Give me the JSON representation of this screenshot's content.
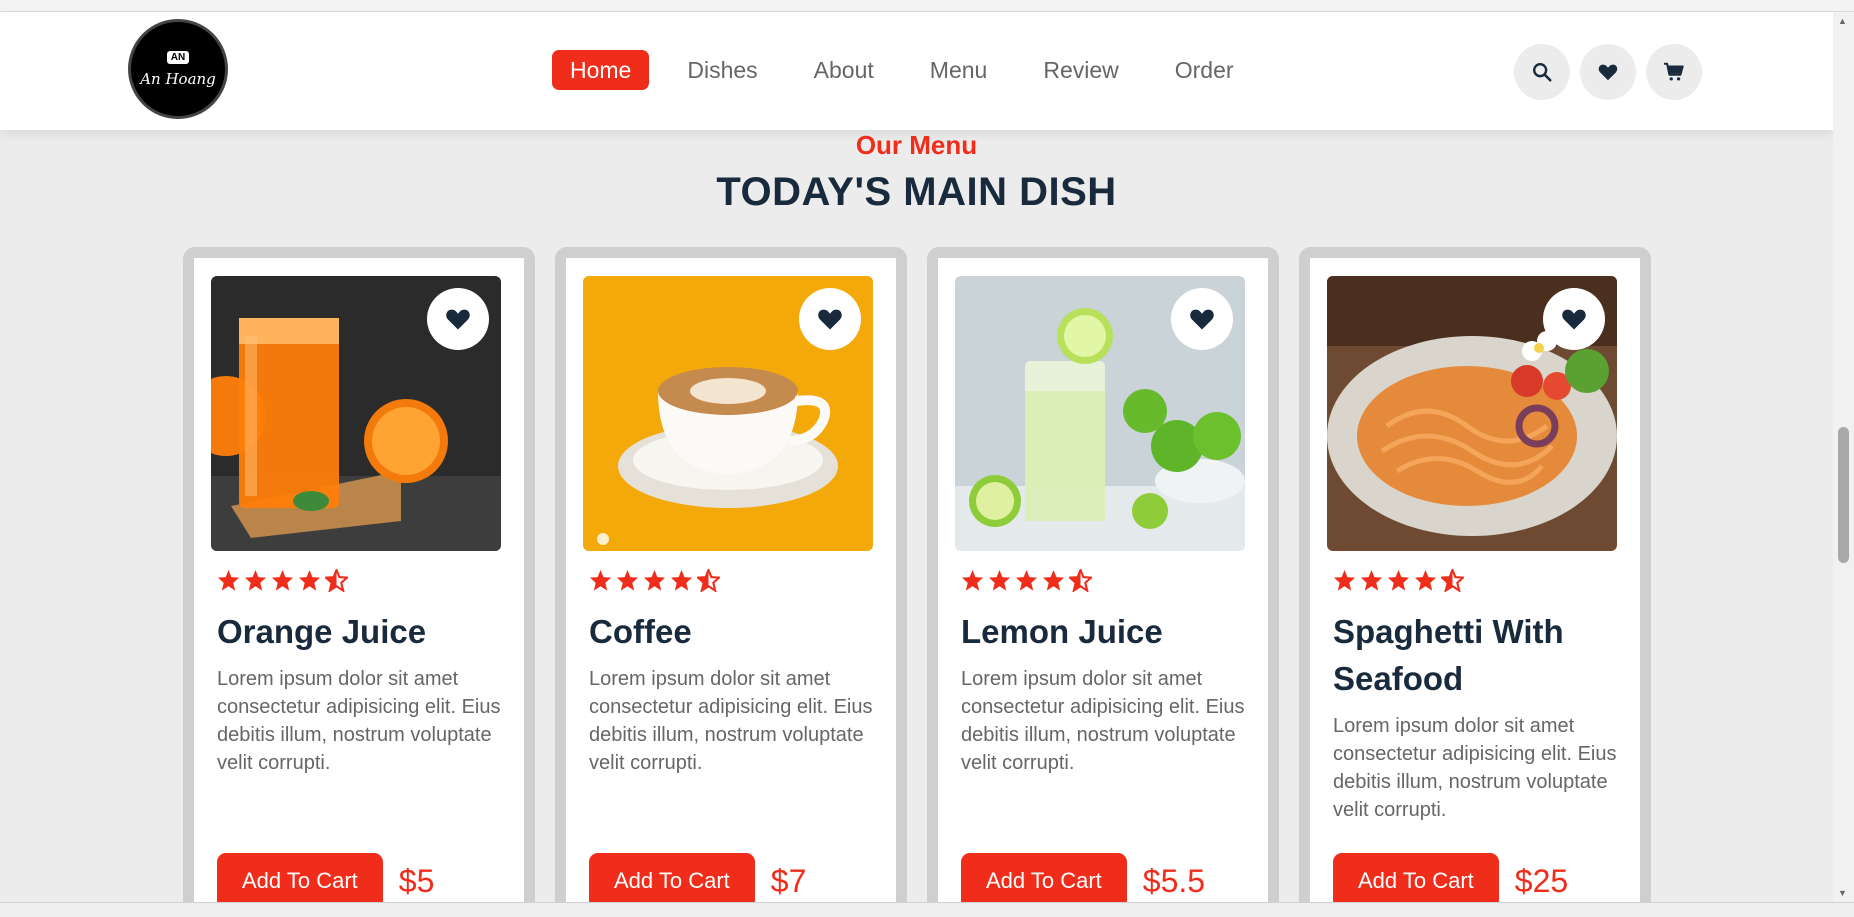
{
  "brand": {
    "badge": "AN",
    "name": "An Hoang"
  },
  "nav": [
    {
      "label": "Home",
      "active": true
    },
    {
      "label": "Dishes"
    },
    {
      "label": "About"
    },
    {
      "label": "Menu"
    },
    {
      "label": "Review"
    },
    {
      "label": "Order"
    }
  ],
  "header_icons": [
    "search-icon",
    "heart-icon",
    "cart-icon"
  ],
  "section": {
    "subtitle": "Our Menu",
    "title": "TODAY'S MAIN DISH"
  },
  "colors": {
    "accent": "#f02d1a",
    "dark": "#192a3d",
    "bg": "#ececec"
  },
  "cards": [
    {
      "name": "Orange Juice",
      "rating": 4.5,
      "description": "Lorem ipsum dolor sit amet consectetur adipisicing elit. Eius debitis illum, nostrum voluptate velit corrupti.",
      "button": "Add To Cart",
      "price": "$5"
    },
    {
      "name": "Coffee",
      "rating": 4.5,
      "description": "Lorem ipsum dolor sit amet consectetur adipisicing elit. Eius debitis illum, nostrum voluptate velit corrupti.",
      "button": "Add To Cart",
      "price": "$7"
    },
    {
      "name": "Lemon Juice",
      "rating": 4.5,
      "description": "Lorem ipsum dolor sit amet consectetur adipisicing elit. Eius debitis illum, nostrum voluptate velit corrupti.",
      "button": "Add To Cart",
      "price": "$5.5"
    },
    {
      "name": "Spaghetti With Seafood",
      "rating": 4.5,
      "description": "Lorem ipsum dolor sit amet consectetur adipisicing elit. Eius debitis illum, nostrum voluptate velit corrupti.",
      "button": "Add To Cart",
      "price": "$25"
    }
  ]
}
